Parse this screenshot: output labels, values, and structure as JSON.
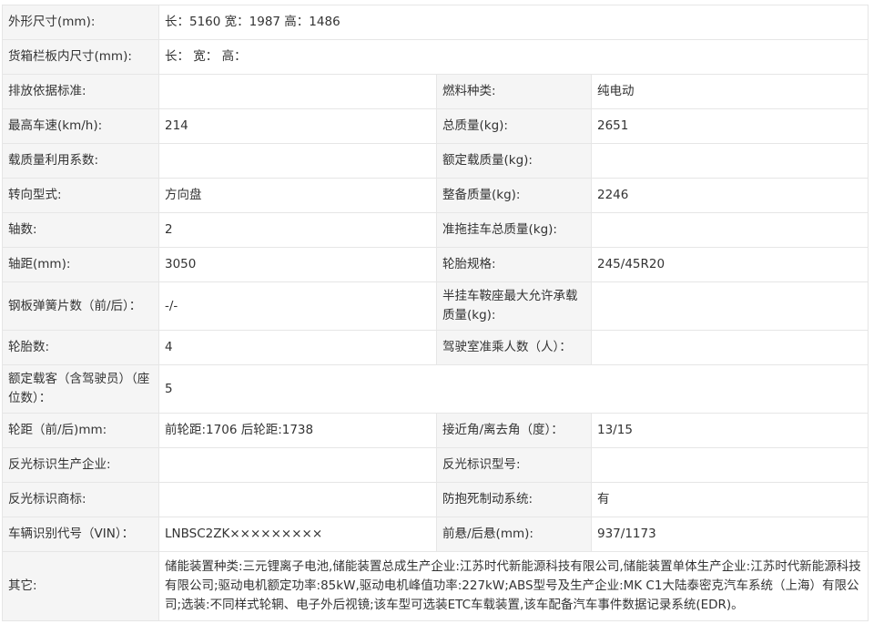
{
  "rows": [
    {
      "l1": "外形尺寸(mm):",
      "v1": "长：5160 宽：1987 高：1486"
    },
    {
      "l1": "货箱栏板内尺寸(mm):",
      "v1": "长： 宽： 高："
    },
    {
      "l1": "排放依据标准:",
      "v1": "",
      "l2": "燃料种类:",
      "v2": "纯电动"
    },
    {
      "l1": "最高车速(km/h):",
      "v1": "214",
      "l2": "总质量(kg):",
      "v2": "2651"
    },
    {
      "l1": "载质量利用系数:",
      "v1": "",
      "l2": "额定载质量(kg):",
      "v2": ""
    },
    {
      "l1": "转向型式:",
      "v1": "方向盘",
      "l2": "整备质量(kg):",
      "v2": "2246"
    },
    {
      "l1": "轴数:",
      "v1": "2",
      "l2": "准拖挂车总质量(kg):",
      "v2": ""
    },
    {
      "l1": "轴距(mm):",
      "v1": "3050",
      "l2": "轮胎规格:",
      "v2": "245/45R20"
    },
    {
      "l1": "钢板弹簧片数（前/后）：",
      "v1": "-/-",
      "l2": "半挂车鞍座最大允许承载质量(kg):",
      "v2": ""
    },
    {
      "l1": "轮胎数:",
      "v1": "4",
      "l2": "驾驶室准乘人数（人）：",
      "v2": ""
    },
    {
      "l1": "额定载客（含驾驶员）（座位数）：",
      "v1": "5"
    },
    {
      "l1": "轮距（前/后)mm:",
      "v1": "前轮距:1706 后轮距:1738",
      "l2": "接近角/离去角（度）：",
      "v2": "13/15"
    },
    {
      "l1": "反光标识生产企业:",
      "v1": "",
      "l2": "反光标识型号:",
      "v2": ""
    },
    {
      "l1": "反光标识商标:",
      "v1": "",
      "l2": "防抱死制动系统:",
      "v2": "有"
    },
    {
      "l1": "车辆识别代号（VIN）：",
      "v1": "LNBSC2ZK×××××××××",
      "l2": "前悬/后悬(mm):",
      "v2": "937/1173"
    },
    {
      "l1": "其它:",
      "v1": "储能装置种类:三元锂离子电池,储能装置总成生产企业:江苏时代新能源科技有限公司,储能装置单体生产企业:江苏时代新能源科技有限公司;驱动电机额定功率:85kW,驱动电机峰值功率:227kW;ABS型号及生产企业:MK C1大陆泰密克汽车系统（上海）有限公司;选装:不同样式轮辋、电子外后视镜;该车型可选装ETC车载装置,该车配备汽车事件数据记录系统(EDR)。"
    }
  ]
}
